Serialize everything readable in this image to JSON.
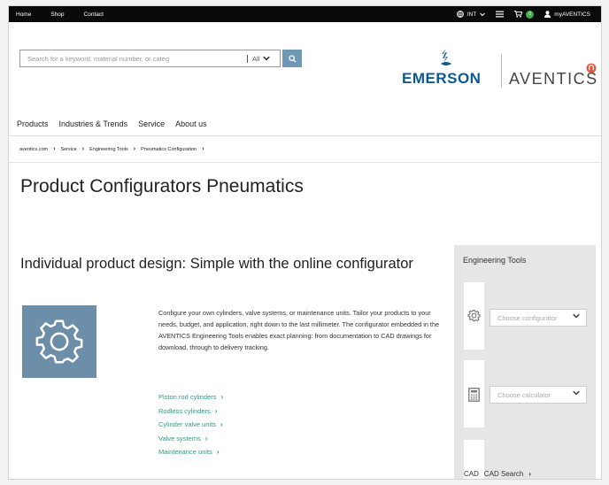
{
  "topbar": {
    "left_links": [
      "Home",
      "Shop",
      "Contact"
    ],
    "region": "INT",
    "cart_count": "0",
    "account": "myAVENTICS"
  },
  "search": {
    "placeholder": "Search for a keyword, material number, or categ",
    "scope": "All"
  },
  "logos": {
    "emerson": "EMERSON",
    "aventics": "AVENTICS"
  },
  "main_nav": [
    "Products",
    "Industries & Trends",
    "Service",
    "About us"
  ],
  "breadcrumb": [
    "aventics.com",
    "Service",
    "Engineering Tools",
    "Pneumatics Configuration"
  ],
  "page_title": "Product Configurators Pneumatics",
  "section": {
    "title": "Individual product design: Simple with the online configurator",
    "description": "Configure your own cylinders, valve systems, or maintenance units. Tailor your products to your needs, budget, and application, right down to the last millimeter. The configurator embedded in the AVENTICS Engineering Tools enables exact planning: from documentation to CAD drawings for download, through to delivery tracking.",
    "links": [
      "Piston rod cylinders",
      "Rodless cylinders",
      "Cylinder valve units",
      "Valve systems",
      "Maintenance units"
    ]
  },
  "sidebar": {
    "title": "Engineering Tools",
    "configurator_placeholder": "Choose configurator",
    "calculator_placeholder": "Choose calculator",
    "cad_icon_label": "CAD",
    "cad_label": "CAD Search"
  },
  "colors": {
    "accent_link": "#2e9c8a",
    "search_button": "#6f98b5",
    "gear_tile": "#6c8ea8",
    "emerson_blue": "#0c5a8e",
    "aventics_orange": "#e2543a"
  }
}
